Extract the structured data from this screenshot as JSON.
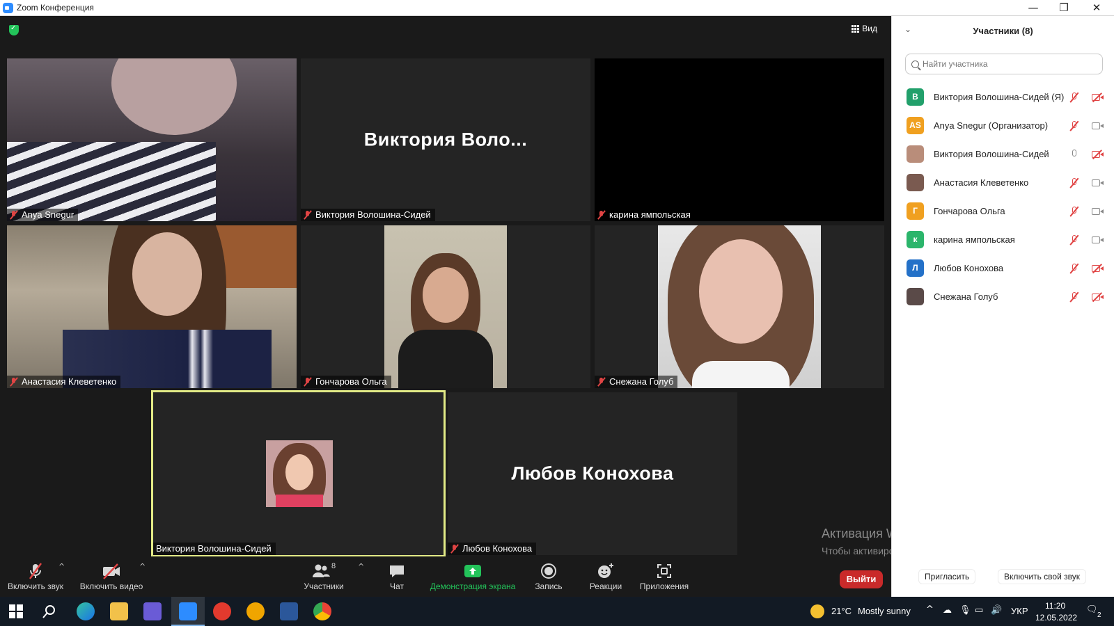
{
  "window": {
    "title": "Zoom Конференция",
    "controls": {
      "minimize": "—",
      "restore": "❐",
      "close": "✕"
    }
  },
  "meeting": {
    "view_label": "Вид",
    "tiles": [
      {
        "name": "Anya Snegur",
        "muted": true,
        "type": "video"
      },
      {
        "name": "Виктория Волошина-Сидей",
        "muted": true,
        "type": "name",
        "display": "Виктория  Воло..."
      },
      {
        "name": "карина ямпольская",
        "muted": true,
        "type": "black"
      },
      {
        "name": "Анастасия Клеветенко",
        "muted": true,
        "type": "video"
      },
      {
        "name": "Гончарова Ольга",
        "muted": true,
        "type": "video"
      },
      {
        "name": "Снежана Голуб",
        "muted": true,
        "type": "video"
      },
      {
        "name": "Виктория Волошина-Сидей",
        "muted": false,
        "type": "photo",
        "active_speaker": true
      },
      {
        "name": "Любов Конохова",
        "muted": true,
        "type": "name",
        "display": "Любов Конохова"
      }
    ]
  },
  "toolbar": {
    "unmute": "Включить звук",
    "start_video": "Включить видео",
    "participants": "Участники",
    "participants_count": "8",
    "chat": "Чат",
    "share": "Демонстрация экрана",
    "record": "Запись",
    "reactions": "Реакции",
    "apps": "Приложения",
    "leave": "Выйти"
  },
  "watermark": {
    "title": "Активация Windows",
    "text": "Чтобы активировать Windows, перейдите в раздел \"Параметры\"."
  },
  "panel": {
    "title": "Участники (8)",
    "search_placeholder": "Найти участника",
    "participants": [
      {
        "initials": "В",
        "name": "Виктория Волошина-Сидей (Я)",
        "color": "#22a06b",
        "mic_off": true,
        "cam_off": true
      },
      {
        "initials": "AS",
        "name": "Anya Snegur (Организатор)",
        "color": "#f0a020",
        "mic_off": true,
        "cam_off": false
      },
      {
        "initials": "",
        "name": "Виктория Волошина-Сидей",
        "color": "#b98d7a",
        "mic_off": false,
        "cam_off": true
      },
      {
        "initials": "",
        "name": "Анастасия Клеветенко",
        "color": "#7a5a50",
        "mic_off": true,
        "cam_off": false
      },
      {
        "initials": "Г",
        "name": "Гончарова Ольга",
        "color": "#f0a020",
        "mic_off": true,
        "cam_off": false
      },
      {
        "initials": "к",
        "name": "карина ямпольская",
        "color": "#2bb56b",
        "mic_off": true,
        "cam_off": false
      },
      {
        "initials": "Л",
        "name": "Любов Конохова",
        "color": "#2471c8",
        "mic_off": true,
        "cam_off": true
      },
      {
        "initials": "",
        "name": "Снежана Голуб",
        "color": "#5a4a48",
        "mic_off": true,
        "cam_off": true
      }
    ],
    "invite": "Пригласить",
    "unmute_me": "Включить свой звук"
  },
  "taskbar": {
    "weather_temp": "21°C",
    "weather_text": "Mostly sunny",
    "lang": "УКР",
    "time": "11:20",
    "date": "12.05.2022",
    "notification_count": "2"
  }
}
